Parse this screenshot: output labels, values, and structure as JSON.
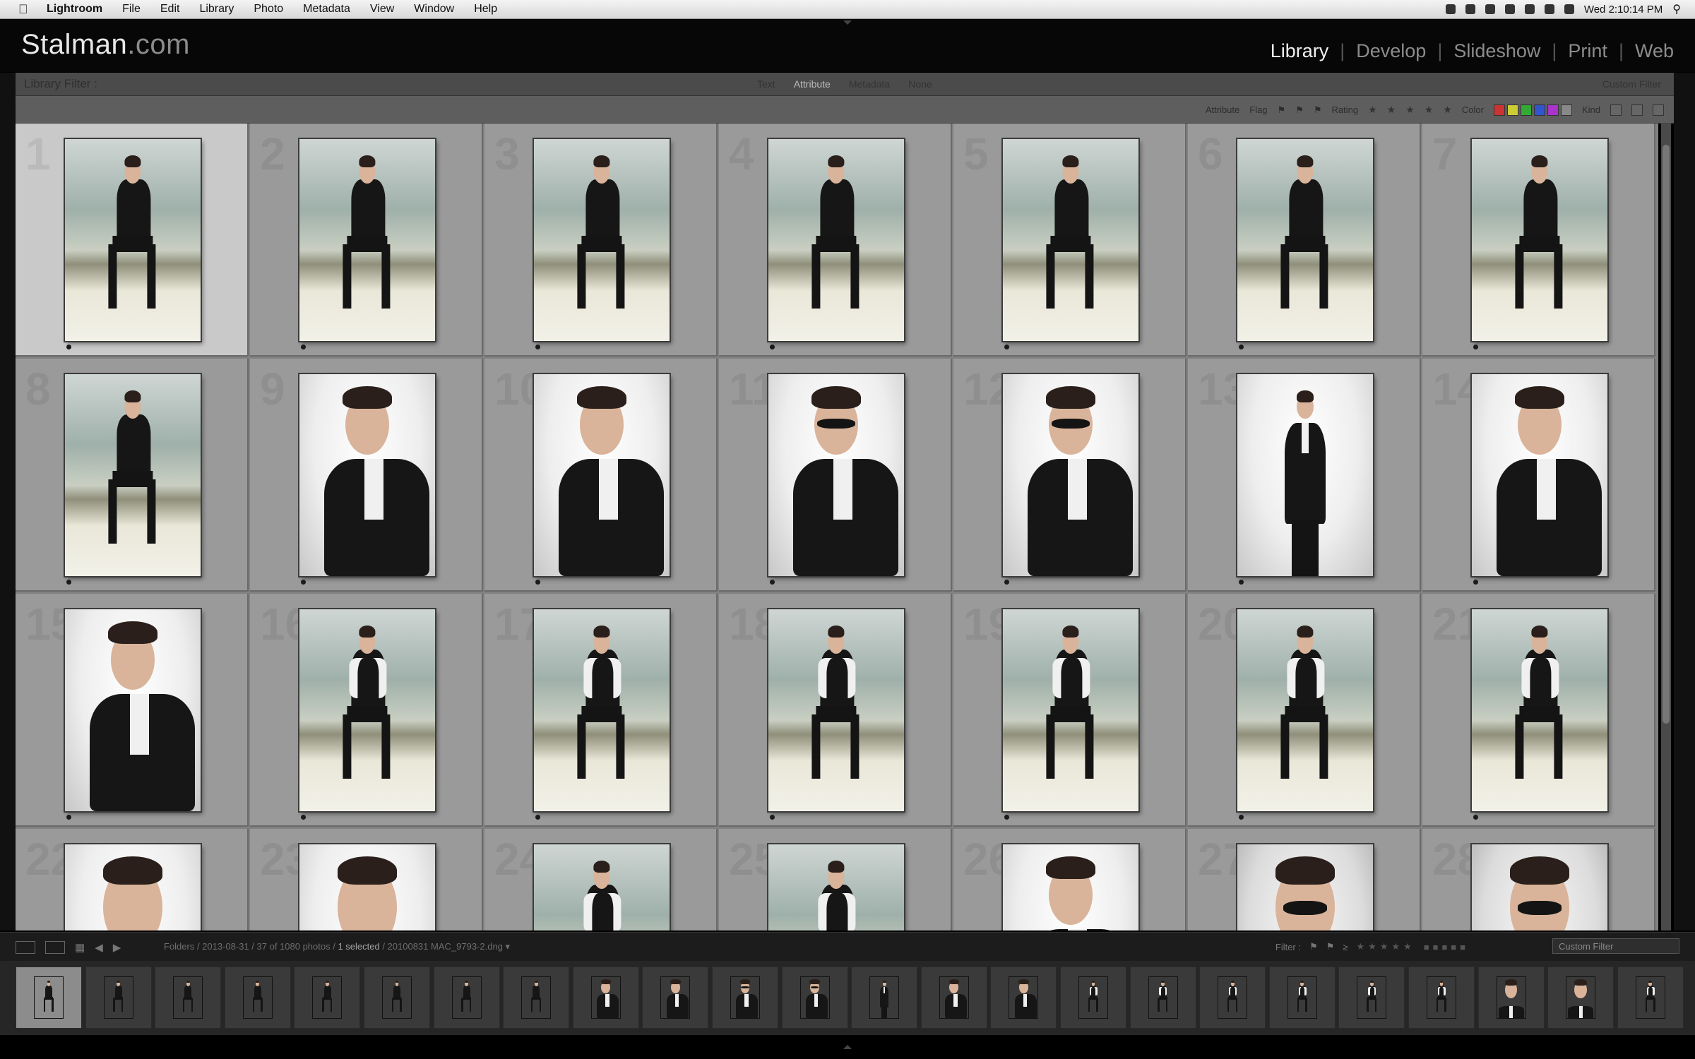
{
  "menubar": {
    "items": [
      "Lightroom",
      "File",
      "Edit",
      "Library",
      "Photo",
      "Metadata",
      "View",
      "Window",
      "Help"
    ],
    "clock": "Wed 2:10:14 PM"
  },
  "identity": {
    "brand_main": "Stalman",
    "brand_domain": ".com",
    "modules": [
      "Library",
      "Develop",
      "Slideshow",
      "Print",
      "Web"
    ],
    "active_module": "Library"
  },
  "library_filter": {
    "title": "Library Filter :",
    "tabs": [
      "Text",
      "Attribute",
      "Metadata",
      "None"
    ],
    "active_tab": "Attribute",
    "preset": "Custom Filter"
  },
  "attribute_bar": {
    "label": "Attribute",
    "flag_label": "Flag",
    "rating_label": "Rating",
    "color_label": "Color",
    "kind_label": "Kind",
    "colors": [
      "#c33",
      "#cc3",
      "#3a3",
      "#35c",
      "#a3c",
      "#888"
    ]
  },
  "grid": {
    "cells": [
      {
        "n": "1",
        "kind": "outdoor-seated",
        "selected": true
      },
      {
        "n": "2",
        "kind": "outdoor-seated"
      },
      {
        "n": "3",
        "kind": "outdoor-seated"
      },
      {
        "n": "4",
        "kind": "outdoor-seated"
      },
      {
        "n": "5",
        "kind": "outdoor-seated"
      },
      {
        "n": "6",
        "kind": "outdoor-seated"
      },
      {
        "n": "7",
        "kind": "outdoor-seated"
      },
      {
        "n": "8",
        "kind": "outdoor-seated"
      },
      {
        "n": "9",
        "kind": "studio-portrait"
      },
      {
        "n": "10",
        "kind": "studio-portrait"
      },
      {
        "n": "11",
        "kind": "studio-sunglasses"
      },
      {
        "n": "12",
        "kind": "studio-sunglasses"
      },
      {
        "n": "13",
        "kind": "studio-standing"
      },
      {
        "n": "14",
        "kind": "studio-portrait"
      },
      {
        "n": "15",
        "kind": "studio-portrait"
      },
      {
        "n": "16",
        "kind": "outdoor-drinking"
      },
      {
        "n": "17",
        "kind": "outdoor-drinking"
      },
      {
        "n": "18",
        "kind": "outdoor-drinking"
      },
      {
        "n": "19",
        "kind": "outdoor-vest"
      },
      {
        "n": "20",
        "kind": "outdoor-vest"
      },
      {
        "n": "21",
        "kind": "outdoor-vest"
      },
      {
        "n": "22",
        "kind": "studio-closeup"
      },
      {
        "n": "23",
        "kind": "studio-closeup"
      },
      {
        "n": "24",
        "kind": "outdoor-vest"
      },
      {
        "n": "25",
        "kind": "outdoor-vest"
      },
      {
        "n": "26",
        "kind": "studio-vest"
      },
      {
        "n": "27",
        "kind": "mirror-sunglasses"
      },
      {
        "n": "28",
        "kind": "mirror-sunglasses"
      }
    ]
  },
  "toolbar": {
    "path_prefix": "Folders / 2013-08-31 / 37 of 1080 photos / ",
    "selected": "1 selected",
    "path_suffix": " / 20100831 MAC_9793-2.dng ▾",
    "filter_label": "Filter :",
    "filter_preset": "Custom Filter"
  },
  "filmstrip": {
    "kinds": [
      "outdoor-seated",
      "outdoor-seated",
      "outdoor-seated",
      "outdoor-seated",
      "outdoor-seated",
      "outdoor-seated",
      "outdoor-seated",
      "outdoor-seated",
      "studio-portrait",
      "studio-portrait",
      "studio-sunglasses",
      "studio-sunglasses",
      "studio-standing",
      "studio-portrait",
      "studio-portrait",
      "outdoor-drinking",
      "outdoor-drinking",
      "outdoor-drinking",
      "outdoor-vest",
      "outdoor-vest",
      "outdoor-vest",
      "studio-closeup",
      "studio-closeup",
      "outdoor-vest"
    ]
  }
}
